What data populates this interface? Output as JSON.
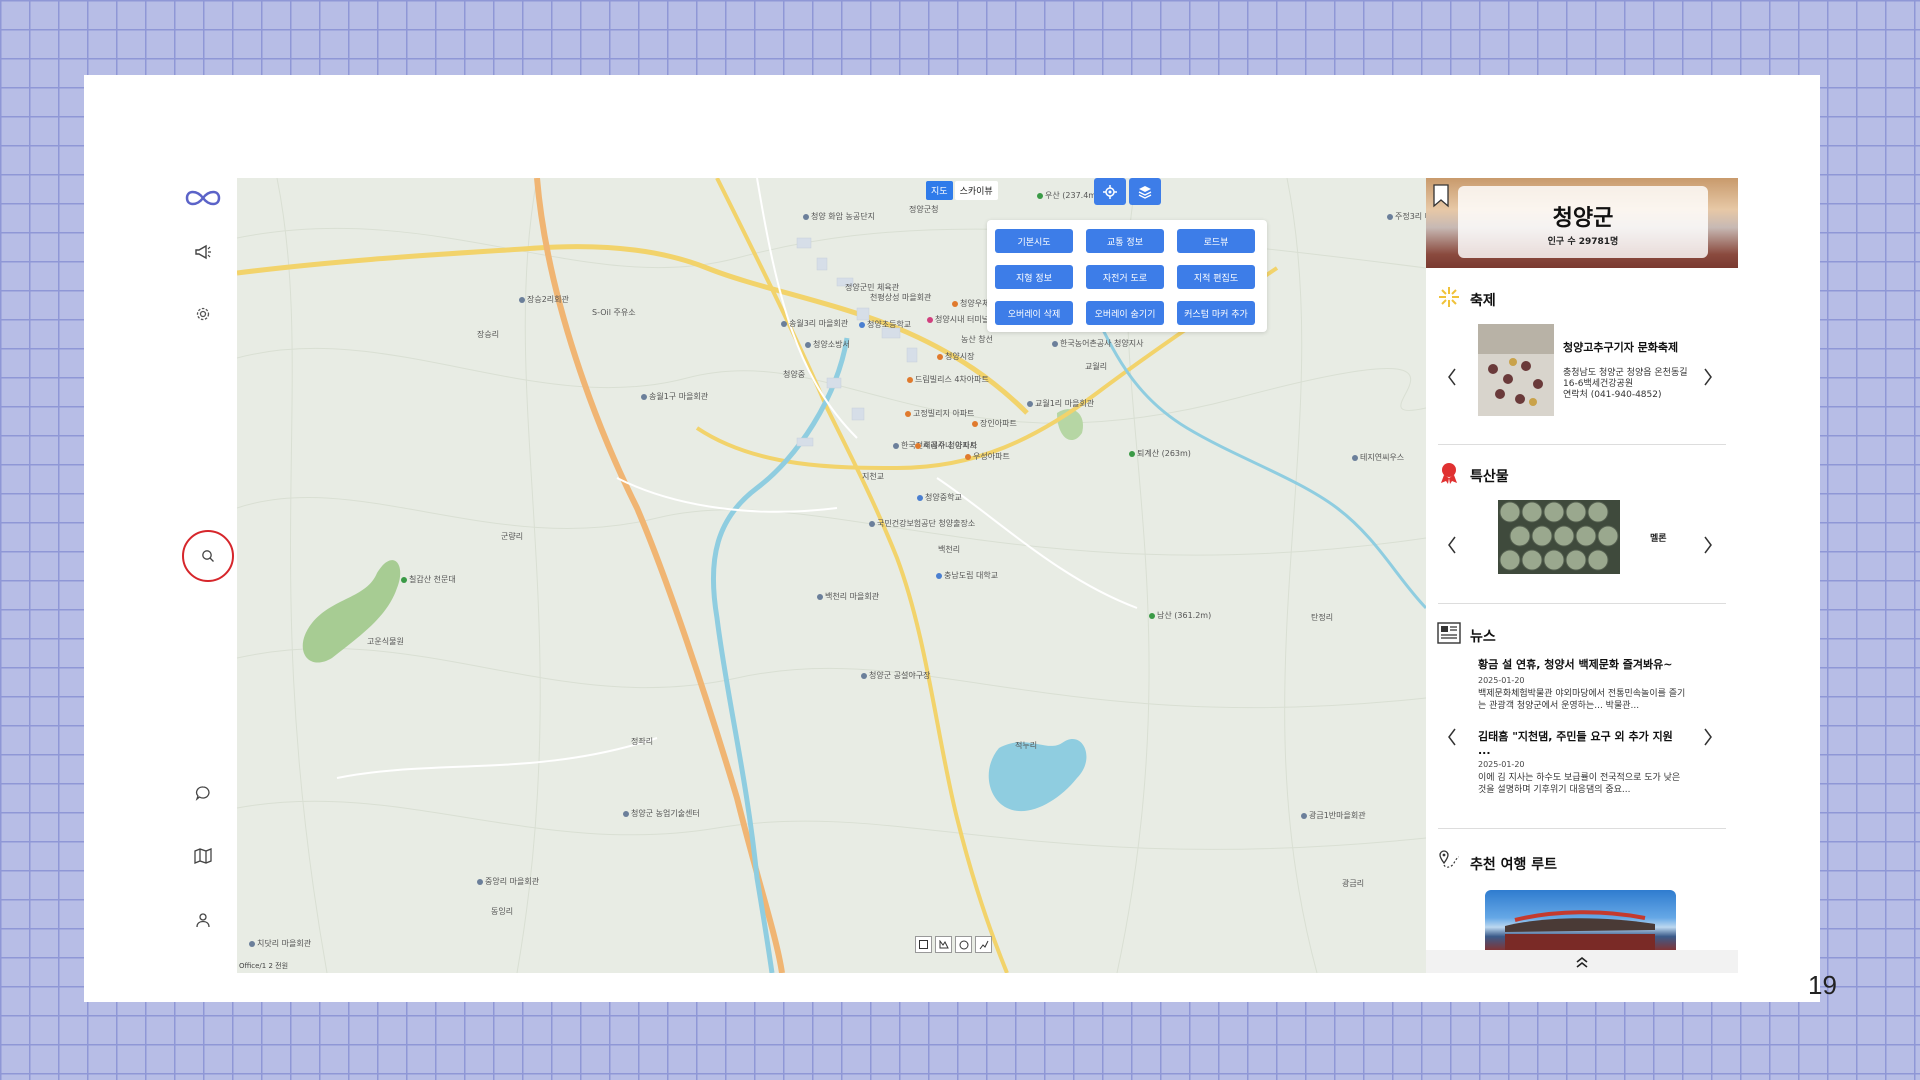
{
  "page_number": "19",
  "map": {
    "type_tabs": [
      "지도",
      "스카이뷰"
    ],
    "attribution": "Office/1  2 전원",
    "layer_buttons": [
      "기본시도",
      "교통 정보",
      "로드뷰",
      "지형 정보",
      "자전거 도로",
      "지적 편집도",
      "오버레이 삭제",
      "오버레이 숨기기",
      "커스텀 마커 추가"
    ],
    "labels": [
      "청양 화암 농공단지",
      "우산 (237.4m)",
      "주정3리 마을회관",
      "정양군청",
      "장승2리회관",
      "S-Oil 주유소",
      "장승리",
      "송월3리 마을회관",
      "정양군민 체육관",
      "천평상성 마을회관",
      "청양소방서",
      "청양초등학교",
      "청양중",
      "청양시내 터미널",
      "농산 창선",
      "청양우체국",
      "청양시장",
      "한국농어촌공사 청양지사",
      "교월리",
      "드림빌리스 4차아파트",
      "송월1구 마을회관",
      "고정빌리지 아파트",
      "교월1리 마을회관",
      "한국전력공사 청양지사",
      "세레주나 아파트",
      "우성아파트",
      "장인아파트",
      "지천교",
      "청양중학교",
      "국민건강보험공단 청양출장소",
      "백천리",
      "충남도립 대학교",
      "백천리 마을회관",
      "군량리",
      "칠갑산 천문대",
      "고운식물원",
      "퇴계산 (263m)",
      "남산 (361.2m)",
      "탄정리",
      "정좌리",
      "적누리",
      "청양군 공설야구장",
      "청양군 농업기술센터",
      "중앙리 마을회관",
      "광금1반마을회관",
      "광금리",
      "동잉리",
      "치닷리 마을회관",
      "테지연씨우스"
    ]
  },
  "panel": {
    "region_name": "청양군",
    "population": "인구 수 29781명",
    "festival": {
      "heading": "축제",
      "title": "청양고추구기자 문화축제",
      "address": "충청남도 청양군 청양읍 온천동길 16-6백세건강공원",
      "contact": "연락처 (041-940-4852)"
    },
    "specialty": {
      "heading": "특산물",
      "name": "멜론"
    },
    "news": {
      "heading": "뉴스",
      "items": [
        {
          "title": "황금 설 연휴, 청양서 백제문화 즐겨봐유~",
          "date": "2025-01-20",
          "body": "백제문화체험박물관 야외마당에서 전통민속놀이를 즐기는 관광객 청양군에서 운영하는... 박물관..."
        },
        {
          "title": "김태흠 \"지천댐, 주민들 요구 외 추가 지원 ...",
          "date": "2025-01-20",
          "body": "이에 김 지사는 하수도 보급률이 전국적으로 도가 낮은 것을 설명하며 기후위기 대응댐의 중요..."
        }
      ]
    },
    "route": {
      "heading": "추천 여행 루트"
    }
  },
  "colors": {
    "accent": "#3d7de8",
    "search_highlight": "#d6262b",
    "grid_background": "#b7bde6"
  }
}
